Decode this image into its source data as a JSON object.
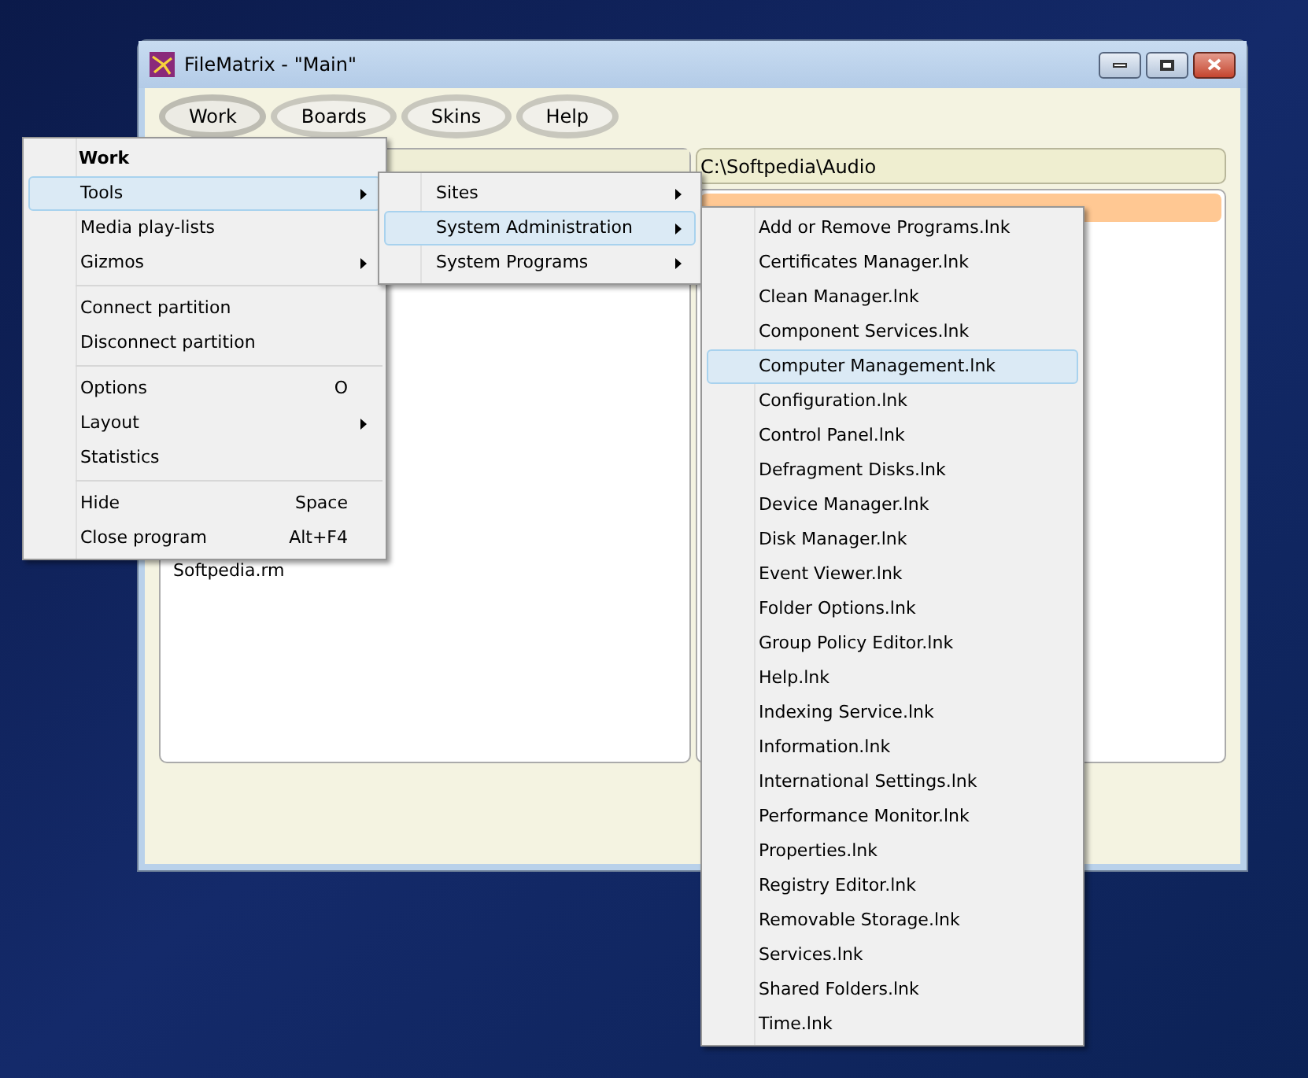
{
  "window": {
    "title": "FileMatrix - \"Main\""
  },
  "toolbar": [
    {
      "label": "Work",
      "selected": true
    },
    {
      "label": "Boards",
      "selected": false
    },
    {
      "label": "Skins",
      "selected": false
    },
    {
      "label": "Help",
      "selected": false
    }
  ],
  "left_panel": {
    "items": [
      "Softpedia.rm"
    ]
  },
  "right_panel": {
    "path": "C:\\Softpedia\\Audio"
  },
  "work_menu": {
    "title": "Work",
    "groups": [
      [
        {
          "label": "Tools",
          "submenu": true,
          "selected": true
        },
        {
          "label": "Media play-lists",
          "submenu": false,
          "selected": false
        },
        {
          "label": "Gizmos",
          "submenu": true,
          "selected": false
        }
      ],
      [
        {
          "label": "Connect partition",
          "submenu": false,
          "selected": false
        },
        {
          "label": "Disconnect partition",
          "submenu": false,
          "selected": false
        }
      ],
      [
        {
          "label": "Options",
          "shortcut": "O",
          "submenu": false,
          "selected": false
        },
        {
          "label": "Layout",
          "submenu": true,
          "selected": false
        },
        {
          "label": "Statistics",
          "submenu": false,
          "selected": false
        }
      ],
      [
        {
          "label": "Hide",
          "shortcut": "Space",
          "submenu": false,
          "selected": false
        },
        {
          "label": "Close program",
          "shortcut": "Alt+F4",
          "submenu": false,
          "selected": false
        }
      ]
    ]
  },
  "tools_menu": [
    {
      "label": "Sites",
      "submenu": true,
      "selected": false
    },
    {
      "label": "System Administration",
      "submenu": true,
      "selected": true
    },
    {
      "label": "System Programs",
      "submenu": true,
      "selected": false
    }
  ],
  "admin_menu": [
    {
      "label": "Add or Remove Programs.lnk",
      "selected": false
    },
    {
      "label": "Certificates Manager.lnk",
      "selected": false
    },
    {
      "label": "Clean Manager.lnk",
      "selected": false
    },
    {
      "label": "Component Services.lnk",
      "selected": false
    },
    {
      "label": "Computer Management.lnk",
      "selected": true
    },
    {
      "label": "Configuration.lnk",
      "selected": false
    },
    {
      "label": "Control Panel.lnk",
      "selected": false
    },
    {
      "label": "Defragment Disks.lnk",
      "selected": false
    },
    {
      "label": "Device Manager.lnk",
      "selected": false
    },
    {
      "label": "Disk Manager.lnk",
      "selected": false
    },
    {
      "label": "Event Viewer.lnk",
      "selected": false
    },
    {
      "label": "Folder Options.lnk",
      "selected": false
    },
    {
      "label": "Group Policy Editor.lnk",
      "selected": false
    },
    {
      "label": "Help.lnk",
      "selected": false
    },
    {
      "label": "Indexing Service.lnk",
      "selected": false
    },
    {
      "label": "Information.lnk",
      "selected": false
    },
    {
      "label": "International Settings.lnk",
      "selected": false
    },
    {
      "label": "Performance Monitor.lnk",
      "selected": false
    },
    {
      "label": "Properties.lnk",
      "selected": false
    },
    {
      "label": "Registry Editor.lnk",
      "selected": false
    },
    {
      "label": "Removable Storage.lnk",
      "selected": false
    },
    {
      "label": "Services.lnk",
      "selected": false
    },
    {
      "label": "Shared Folders.lnk",
      "selected": false
    },
    {
      "label": "Time.lnk",
      "selected": false
    }
  ]
}
